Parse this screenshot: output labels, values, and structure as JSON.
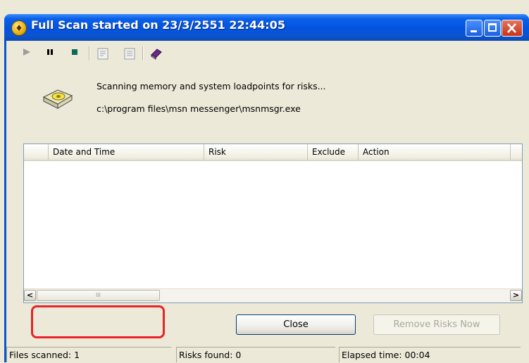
{
  "window": {
    "title": "Full Scan started on 23/3/2551 22:44:05",
    "icon": "scan-shield-icon"
  },
  "title_buttons": {
    "minimize": "minimize-icon",
    "maximize": "maximize-icon",
    "close": "close-icon"
  },
  "toolbar": {
    "items": [
      "play-icon",
      "pause-icon",
      "stop-icon",
      "properties-icon",
      "details-icon",
      "help-book-icon"
    ]
  },
  "status": {
    "line1": "Scanning memory and system loadpoints for risks...",
    "line2": "c:\\program files\\msn messenger\\msnmsgr.exe"
  },
  "table": {
    "columns": [
      "",
      "Date and Time",
      "Risk",
      "Exclude",
      "Action",
      ""
    ],
    "rows": [],
    "scroll_thumb_label": "III"
  },
  "buttons": {
    "close_label": "Close",
    "remove_label": "Remove Risks Now"
  },
  "statusbar": {
    "files_scanned": "Files scanned: 1",
    "risks_found": "Risks found: 0",
    "elapsed": "Elapsed time: 00:04"
  },
  "colors": {
    "titlebar": "#0353df",
    "face": "#ece9d8",
    "highlight": "#e8242a"
  }
}
